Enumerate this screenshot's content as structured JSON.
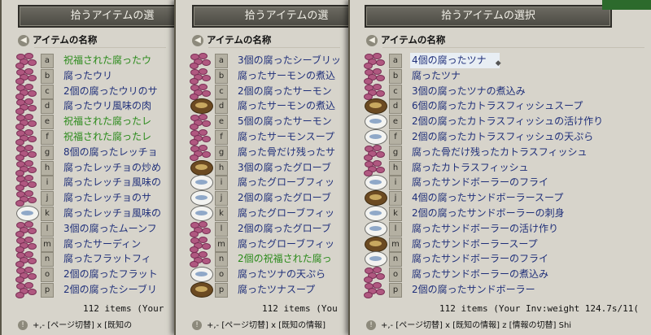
{
  "windows": [
    {
      "title": "拾うアイテムの選",
      "header": "アイテムの名称",
      "items": [
        {
          "letter": "a",
          "name": "祝福された腐ったウ",
          "color": "green",
          "icon": "blob"
        },
        {
          "letter": "b",
          "name": "腐ったウリ",
          "color": "blue",
          "icon": "blob"
        },
        {
          "letter": "c",
          "name": "2個の腐ったウリのサ",
          "color": "blue",
          "icon": "blob"
        },
        {
          "letter": "d",
          "name": "腐ったウリ風味の肉",
          "color": "blue",
          "icon": "blob"
        },
        {
          "letter": "e",
          "name": "祝福された腐ったレ",
          "color": "green",
          "icon": "blob"
        },
        {
          "letter": "f",
          "name": "祝福された腐ったレ",
          "color": "green",
          "icon": "blob"
        },
        {
          "letter": "g",
          "name": "8個の腐ったレッチョ",
          "color": "blue",
          "icon": "blob"
        },
        {
          "letter": "h",
          "name": "腐ったレッチョの炒め",
          "color": "blue",
          "icon": "blob"
        },
        {
          "letter": "i",
          "name": "腐ったレッチョ風味の",
          "color": "blue",
          "icon": "blob"
        },
        {
          "letter": "j",
          "name": "腐ったレッチョのサ",
          "color": "blue",
          "icon": "blob"
        },
        {
          "letter": "k",
          "name": "腐ったレッチョ風味の",
          "color": "blue",
          "icon": "plate"
        },
        {
          "letter": "l",
          "name": "3個の腐ったムーンフ",
          "color": "blue",
          "icon": "blob"
        },
        {
          "letter": "m",
          "name": "腐ったサーディン",
          "color": "blue",
          "icon": "blob"
        },
        {
          "letter": "n",
          "name": "腐ったフラットフィ",
          "color": "blue",
          "icon": "blob"
        },
        {
          "letter": "o",
          "name": "2個の腐ったフラット",
          "color": "blue",
          "icon": "blob"
        },
        {
          "letter": "p",
          "name": "2個の腐ったシーブリ",
          "color": "blue",
          "icon": "blob"
        }
      ],
      "count": "112 items  (Your",
      "footer": "+,- [ページ切替]  x [既知の"
    },
    {
      "title": "拾うアイテムの選",
      "header": "アイテムの名称",
      "items": [
        {
          "letter": "a",
          "name": "3個の腐ったシーブリッ",
          "color": "blue",
          "icon": "blob"
        },
        {
          "letter": "b",
          "name": "腐ったサーモンの煮込",
          "color": "blue",
          "icon": "blob"
        },
        {
          "letter": "c",
          "name": "2個の腐ったサーモン",
          "color": "blue",
          "icon": "blob"
        },
        {
          "letter": "d",
          "name": "腐ったサーモンの煮込",
          "color": "blue",
          "icon": "bowl"
        },
        {
          "letter": "e",
          "name": "5個の腐ったサーモン",
          "color": "blue",
          "icon": "blob"
        },
        {
          "letter": "f",
          "name": "腐ったサーモンスープ",
          "color": "blue",
          "icon": "blob"
        },
        {
          "letter": "g",
          "name": "腐った骨だけ残ったサ",
          "color": "blue",
          "icon": "blob"
        },
        {
          "letter": "h",
          "name": "3個の腐ったグローブ",
          "color": "blue",
          "icon": "bowl"
        },
        {
          "letter": "i",
          "name": "腐ったグローブフィッ",
          "color": "blue",
          "icon": "plate"
        },
        {
          "letter": "j",
          "name": "2個の腐ったグローブ",
          "color": "blue",
          "icon": "plate"
        },
        {
          "letter": "k",
          "name": "腐ったグローブフィッ",
          "color": "blue",
          "icon": "plate"
        },
        {
          "letter": "l",
          "name": "2個の腐ったグローブ",
          "color": "blue",
          "icon": "blob"
        },
        {
          "letter": "m",
          "name": "腐ったグローブフィッ",
          "color": "blue",
          "icon": "blob"
        },
        {
          "letter": "n",
          "name": "2個の祝福された腐っ",
          "color": "green",
          "icon": "blob"
        },
        {
          "letter": "o",
          "name": "腐ったツナの天ぷら",
          "color": "blue",
          "icon": "plate"
        },
        {
          "letter": "p",
          "name": "腐ったツナスープ",
          "color": "blue",
          "icon": "bowl"
        }
      ],
      "count": "112 items  (You",
      "footer": "+,- [ページ切替]  x [既知の情報]"
    },
    {
      "title": "拾うアイテムの選択",
      "header": "アイテムの名称",
      "items": [
        {
          "letter": "a",
          "name": "4個の腐ったツナ",
          "color": "blue",
          "icon": "blob",
          "selected": true
        },
        {
          "letter": "b",
          "name": "腐ったツナ",
          "color": "blue",
          "icon": "blob"
        },
        {
          "letter": "c",
          "name": "3個の腐ったツナの煮込み",
          "color": "blue",
          "icon": "blob"
        },
        {
          "letter": "d",
          "name": "6個の腐ったカトラスフィッシュスープ",
          "color": "blue",
          "icon": "bowl"
        },
        {
          "letter": "e",
          "name": "2個の腐ったカトラスフィッシュの活け作り",
          "color": "blue",
          "icon": "plate"
        },
        {
          "letter": "f",
          "name": "2個の腐ったカトラスフィッシュの天ぷら",
          "color": "blue",
          "icon": "plate"
        },
        {
          "letter": "g",
          "name": "腐った骨だけ残ったカトラスフィッシュ",
          "color": "blue",
          "icon": "blob"
        },
        {
          "letter": "h",
          "name": "腐ったカトラスフィッシュ",
          "color": "blue",
          "icon": "blob"
        },
        {
          "letter": "i",
          "name": "腐ったサンドボーラーのフライ",
          "color": "blue",
          "icon": "plate"
        },
        {
          "letter": "j",
          "name": "4個の腐ったサンドボーラースープ",
          "color": "blue",
          "icon": "bowl"
        },
        {
          "letter": "k",
          "name": "2個の腐ったサンドボーラーの刺身",
          "color": "blue",
          "icon": "plate"
        },
        {
          "letter": "l",
          "name": "腐ったサンドボーラーの活け作り",
          "color": "blue",
          "icon": "plate"
        },
        {
          "letter": "m",
          "name": "腐ったサンドボーラースープ",
          "color": "blue",
          "icon": "bowl"
        },
        {
          "letter": "n",
          "name": "腐ったサンドボーラーのフライ",
          "color": "blue",
          "icon": "plate"
        },
        {
          "letter": "o",
          "name": "腐ったサンドボーラーの煮込み",
          "color": "blue",
          "icon": "blob"
        },
        {
          "letter": "p",
          "name": "2個の腐ったサンドボーラー",
          "color": "blue",
          "icon": "blob"
        }
      ],
      "count": "112 items  (Your Inv:weight 124.7s/11(",
      "footer": "+,- [ページ切替]  x [既知の情報]  z [情報の切替]  Shi"
    }
  ]
}
